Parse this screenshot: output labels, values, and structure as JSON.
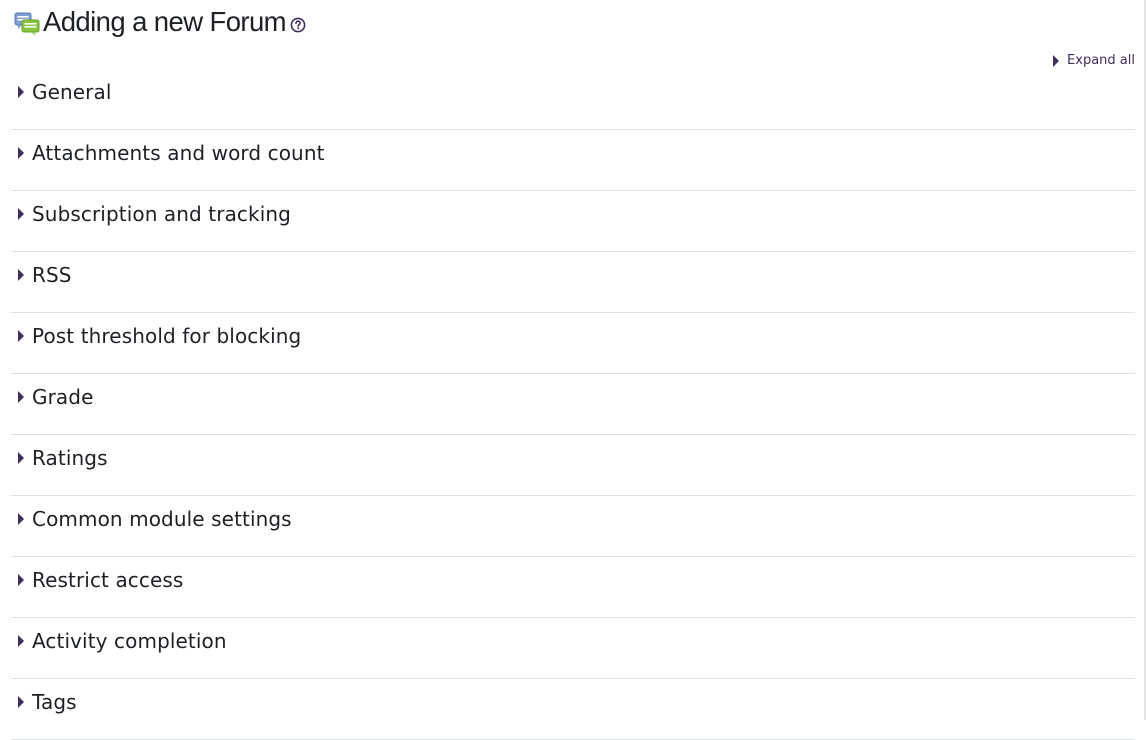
{
  "header": {
    "title": "Adding a new Forum",
    "module_icon": "forum-icon",
    "help_icon": "help-icon"
  },
  "toolbar": {
    "expand_all_label": "Expand all"
  },
  "sections": [
    {
      "label": "General"
    },
    {
      "label": "Attachments and word count"
    },
    {
      "label": "Subscription and tracking"
    },
    {
      "label": "RSS"
    },
    {
      "label": "Post threshold for blocking"
    },
    {
      "label": "Grade"
    },
    {
      "label": "Ratings"
    },
    {
      "label": "Common module settings"
    },
    {
      "label": "Restrict access"
    },
    {
      "label": "Activity completion"
    },
    {
      "label": "Tags"
    }
  ],
  "colors": {
    "accent": "#3e2f5b",
    "text": "#1d2125",
    "divider": "#dee2e6",
    "icon_blue": "#7f9ed4",
    "icon_green": "#8ac53f"
  }
}
